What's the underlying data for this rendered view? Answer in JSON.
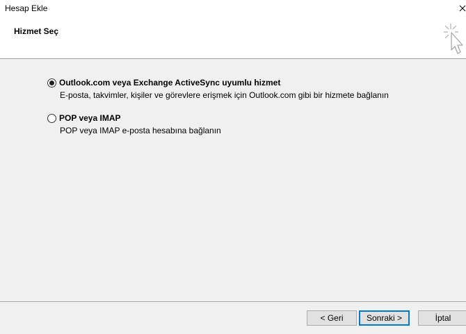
{
  "window": {
    "title": "Hesap Ekle"
  },
  "header": {
    "title": "Hizmet Seç",
    "icon": "cursor-sparkle-icon"
  },
  "options": [
    {
      "label": "Outlook.com veya Exchange ActiveSync uyumlu hizmet",
      "description": "E-posta, takvimler, kişiler ve görevlere erişmek için Outlook.com gibi bir hizmete bağlanın",
      "selected": true
    },
    {
      "label": "POP veya IMAP",
      "description": "POP veya IMAP e-posta hesabına bağlanın",
      "selected": false
    }
  ],
  "buttons": {
    "back": "< Geri",
    "next": "Sonraki >",
    "cancel": "İptal"
  },
  "colors": {
    "accent": "#0078d7",
    "background": "#f0f0f0",
    "header_bg": "#ffffff"
  }
}
